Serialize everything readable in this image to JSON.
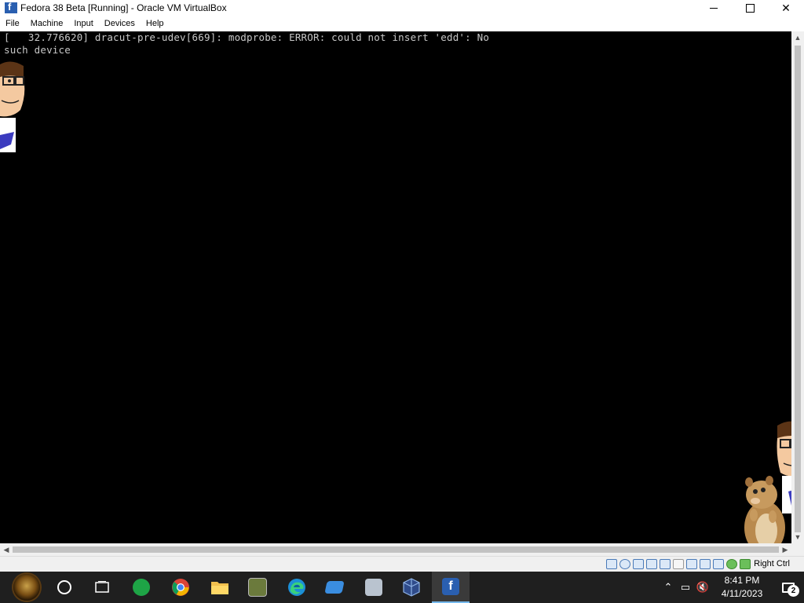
{
  "window": {
    "title": "Fedora 38 Beta [Running] - Oracle VM VirtualBox",
    "icon": "virtualbox-fedora-icon"
  },
  "menu": [
    "File",
    "Machine",
    "Input",
    "Devices",
    "Help"
  ],
  "console": {
    "lines": [
      "[   32.776620] dracut-pre-udev[669]: modprobe: ERROR: could not insert 'edd': No",
      "such device"
    ]
  },
  "statusbar": {
    "host_key": "Right Ctrl",
    "icons": [
      "hard-disk-icon",
      "optical-drive-icon",
      "audio-icon",
      "network-icon",
      "usb-icon",
      "shared-folders-icon",
      "display-icon",
      "video-capture-icon",
      "mouse-integration-icon",
      "guest-additions-icon",
      "green-status-icon"
    ]
  },
  "taskbar": {
    "apps": [
      "start-button",
      "cortana-button",
      "task-view-button",
      "green-app",
      "chrome",
      "file-explorer",
      "game-app",
      "edge",
      "app-blue",
      "remote-desktop-app",
      "virtualbox-manager",
      "fedora-vm-window"
    ],
    "time": "8:41 PM",
    "date": "4/11/2023",
    "notification_count": "2"
  },
  "colors": {
    "console_bg": "#000000",
    "console_text": "#c8c8c8",
    "taskbar_bg": "#1f1f1f",
    "active_underline": "#76b9ed"
  }
}
